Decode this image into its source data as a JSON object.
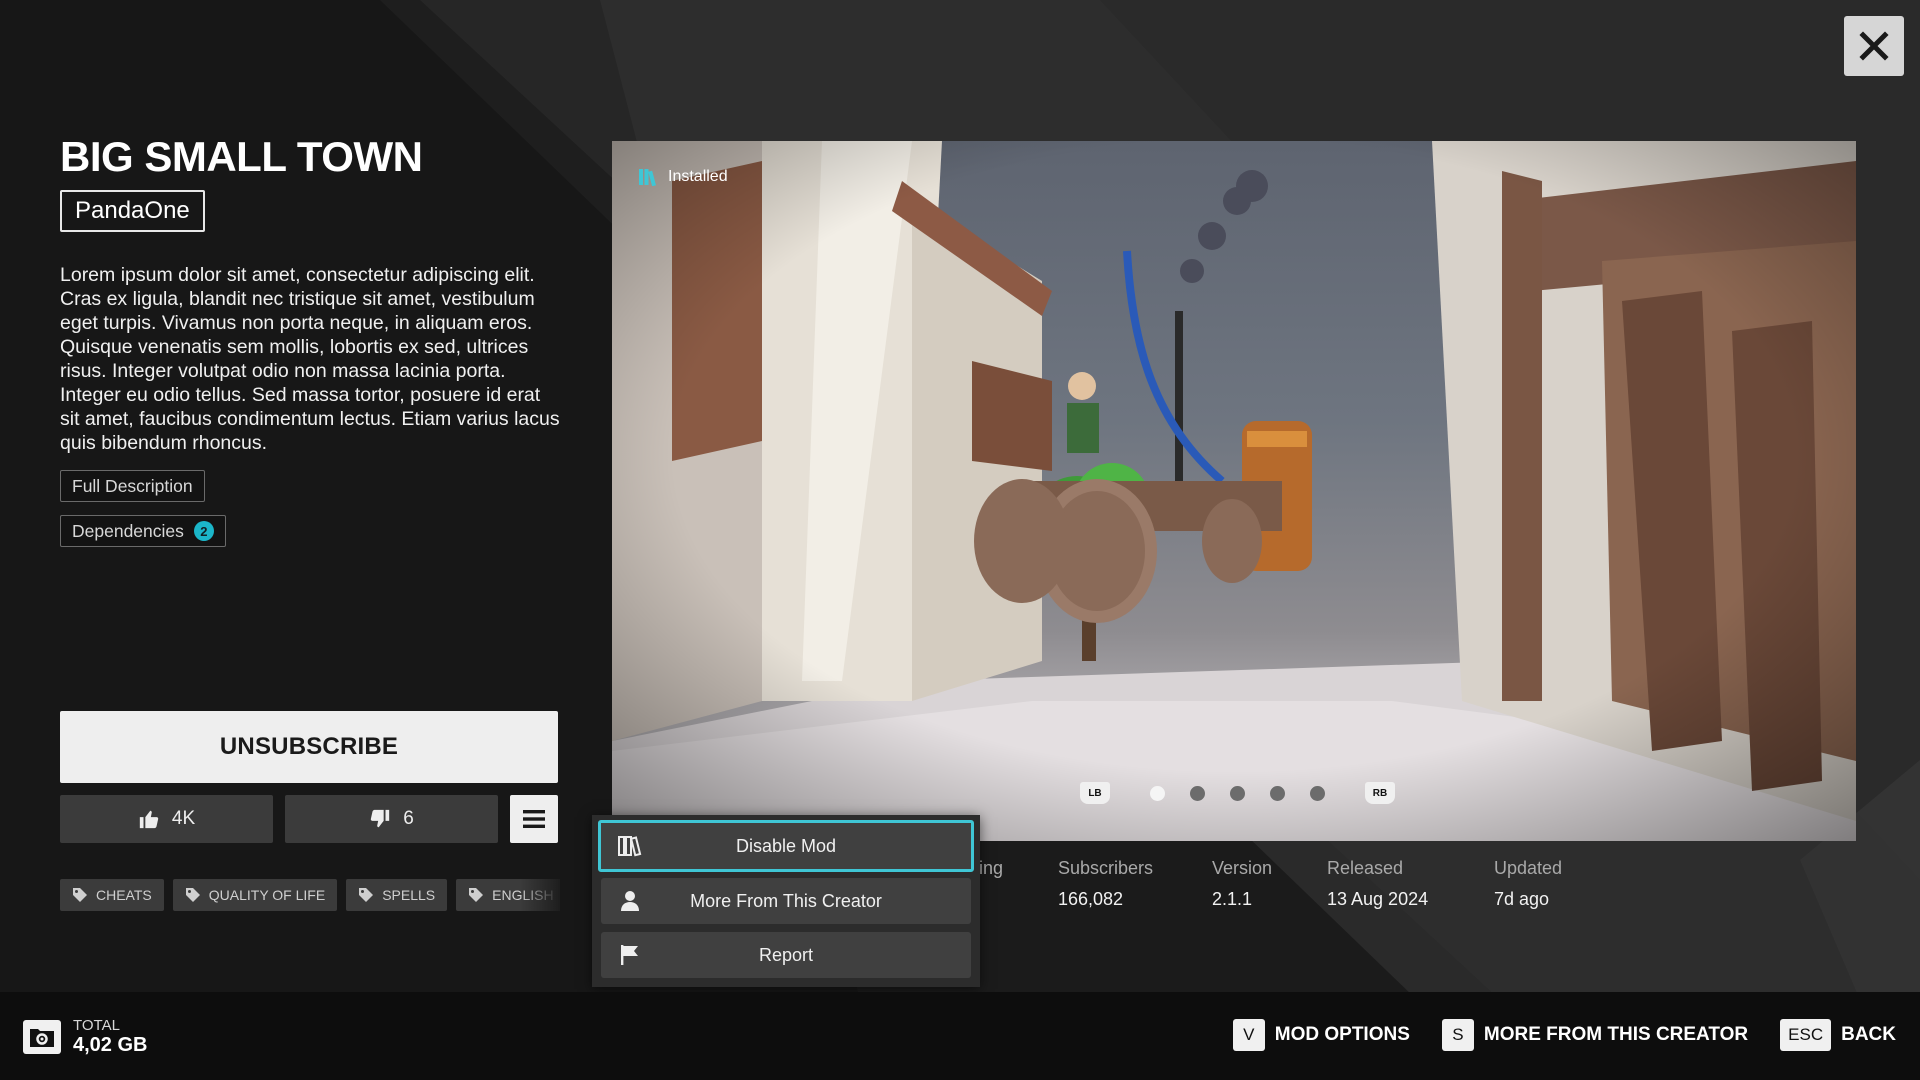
{
  "window": {
    "close_icon": "close-icon"
  },
  "mod": {
    "title": "BIG SMALL TOWN",
    "creator": "PandaOne",
    "description": "Lorem ipsum dolor sit amet, consectetur adipiscing elit. Cras ex ligula, blandit nec tristique sit amet, vestibulum eget turpis. Vivamus non porta neque, in aliquam eros. Quisque venenatis sem mollis, lobortis ex sed, ultrices risus. Integer volutpat odio non massa lacinia porta. Integer eu odio tellus. Sed massa tortor, posuere id erat sit amet, faucibus condimentum lectus. Etiam varius lacus quis bibendum rhoncus.",
    "full_description_label": "Full Description",
    "dependencies_label": "Dependencies",
    "dependencies_count": "2"
  },
  "actions": {
    "unsubscribe_label": "UNSUBSCRIBE",
    "likes": "4K",
    "dislikes": "6"
  },
  "tags": [
    "CHEATS",
    "QUALITY OF LIFE",
    "SPELLS",
    "ENGLISH"
  ],
  "preview": {
    "installed_label": "Installed",
    "left_shoulder": "LB",
    "right_shoulder": "RB",
    "slide_count": 5,
    "active_slide": 1
  },
  "stats": {
    "rating_label_partial": "ing",
    "subscribers_label": "Subscribers",
    "subscribers_value": "166,082",
    "version_label": "Version",
    "version_value": "2.1.1",
    "released_label": "Released",
    "released_value": "13 Aug 2024",
    "updated_label": "Updated",
    "updated_value": "7d ago"
  },
  "options_menu": {
    "items": [
      {
        "label": "Disable Mod",
        "icon": "books-icon",
        "selected": true
      },
      {
        "label": "More From This Creator",
        "icon": "person-icon",
        "selected": false
      },
      {
        "label": "Report",
        "icon": "flag-icon",
        "selected": false
      }
    ]
  },
  "footer": {
    "total_label": "TOTAL",
    "total_value": "4,02 GB",
    "hints": [
      {
        "key": "V",
        "label": "MOD OPTIONS"
      },
      {
        "key": "S",
        "label": "MORE FROM THIS CREATOR"
      },
      {
        "key": "ESC",
        "label": "BACK"
      }
    ]
  },
  "colors": {
    "accent": "#3fc6d5",
    "badge": "#1bb6c9",
    "background": "#2a2a2a",
    "footer": "#0d0d0d"
  }
}
